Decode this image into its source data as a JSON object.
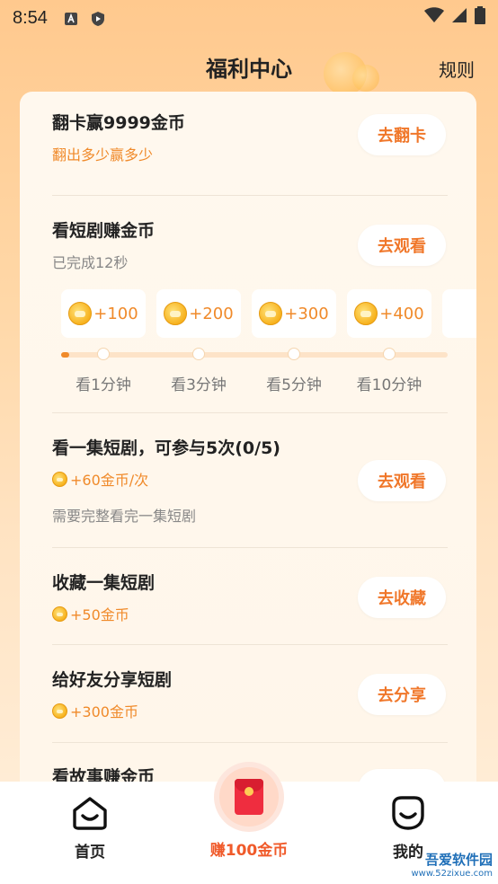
{
  "status_bar": {
    "time": "8:54"
  },
  "header": {
    "title": "福利中心",
    "rules": "规则"
  },
  "tasks": {
    "flip": {
      "title": "翻卡赢9999金币",
      "sub": "翻出多少赢多少",
      "button": "去翻卡"
    },
    "watch": {
      "title": "看短剧赚金币",
      "sub": "已完成12秒",
      "button": "去观看",
      "rewards": [
        "+100",
        "+200",
        "+300",
        "+400"
      ],
      "steps": [
        "看1分钟",
        "看3分钟",
        "看5分钟",
        "看10分钟"
      ],
      "progress": 0.01
    },
    "episode": {
      "title": "看一集短剧，可参与5次(0/5)",
      "sub": "+60金币/次",
      "note": "需要完整看完一集短剧",
      "button": "去观看"
    },
    "collect": {
      "title": "收藏一集短剧",
      "sub": "+50金币",
      "button": "去收藏"
    },
    "share": {
      "title": "给好友分享短剧",
      "sub": "+300金币",
      "button": "去分享"
    },
    "story": {
      "title": "看故事赚金币"
    }
  },
  "bottom_nav": {
    "home": "首页",
    "earn": "赚100金币",
    "mine": "我的"
  },
  "watermark": {
    "main": "吾爱软件园",
    "url": "www.52zixue.com"
  },
  "colors": {
    "accent": "#f08a2a",
    "button_text": "#f0772a",
    "earn_label": "#f05a2a"
  }
}
